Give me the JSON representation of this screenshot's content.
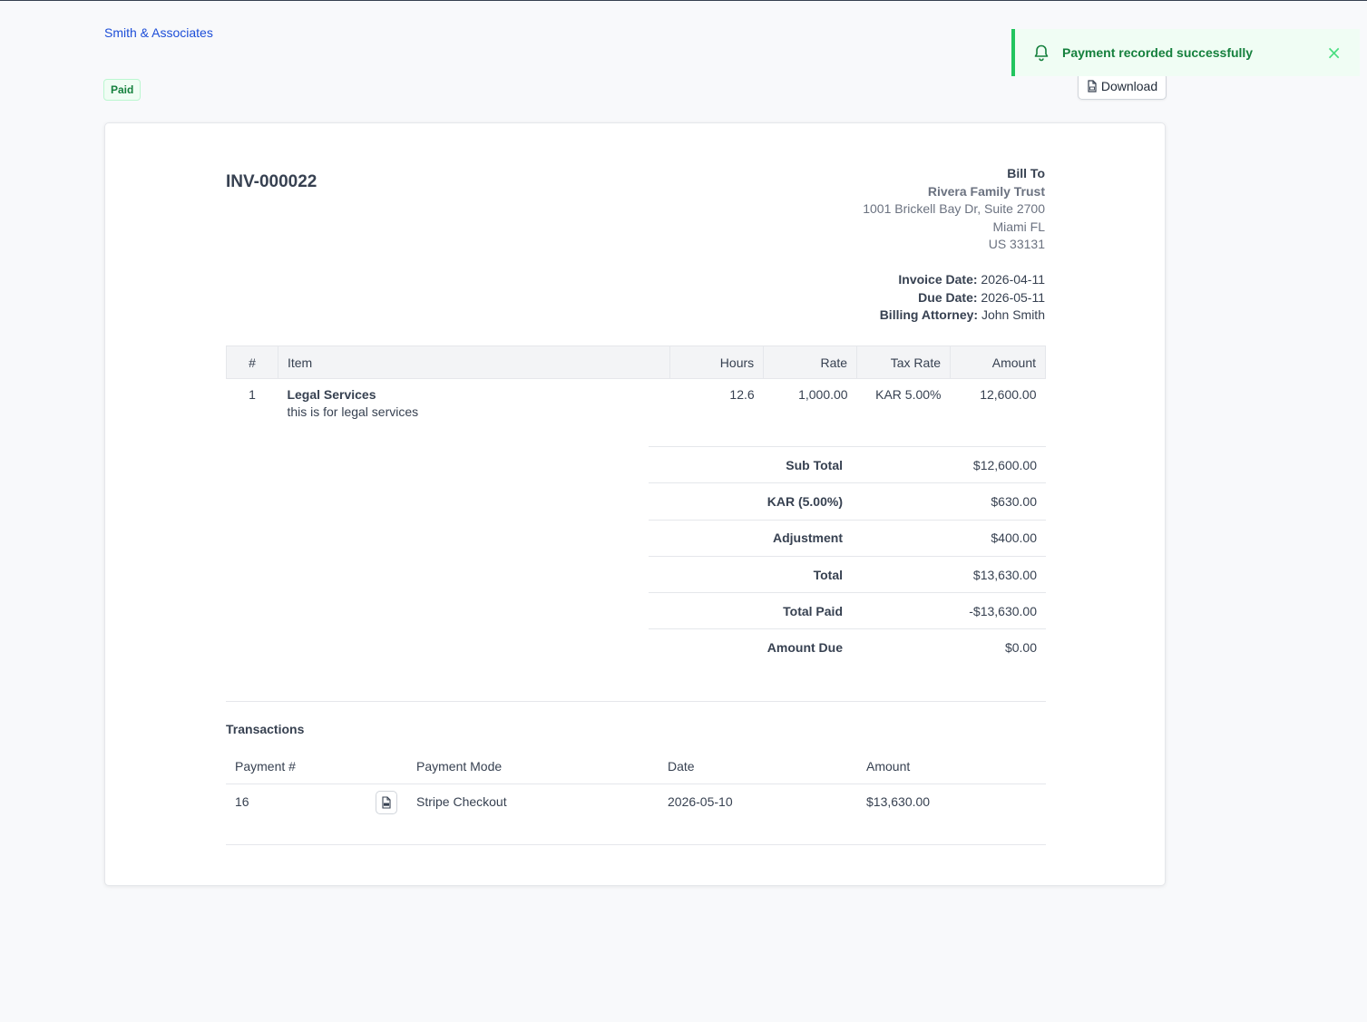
{
  "header": {
    "firm_name": "Smith & Associates",
    "status": "Paid",
    "download_label": "Download"
  },
  "toast": {
    "message": "Payment recorded successfully",
    "close": "×"
  },
  "invoice": {
    "number": "INV-000022",
    "bill_to": {
      "heading": "Bill To",
      "name": "Rivera Family Trust",
      "address_line1": "1001 Brickell Bay Dr, Suite 2700",
      "address_line2": "Miami FL",
      "address_line3": "US 33131"
    },
    "meta": {
      "invoice_date_label": "Invoice Date:",
      "invoice_date": "2026-04-11",
      "due_date_label": "Due Date:",
      "due_date": "2026-05-11",
      "attorney_label": "Billing Attorney:",
      "attorney": "John Smith"
    },
    "items_table": {
      "headers": [
        "#",
        "Item",
        "Hours",
        "Rate",
        "Tax Rate",
        "Amount"
      ],
      "rows": [
        {
          "num": "1",
          "name": "Legal Services",
          "description": "this is for legal services",
          "hours": "12.6",
          "rate": "1,000.00",
          "tax_rate": "KAR 5.00%",
          "amount": "12,600.00"
        }
      ]
    },
    "totals": [
      {
        "label": "Sub Total",
        "value": "$12,600.00"
      },
      {
        "label": "KAR (5.00%)",
        "value": "$630.00"
      },
      {
        "label": "Adjustment",
        "value": "$400.00"
      },
      {
        "label": "Total",
        "value": "$13,630.00"
      },
      {
        "label": "Total Paid",
        "value": "-$13,630.00"
      },
      {
        "label": "Amount Due",
        "value": "$0.00"
      }
    ]
  },
  "transactions": {
    "title": "Transactions",
    "headers": [
      "Payment #",
      "Payment Mode",
      "Date",
      "Amount"
    ],
    "rows": [
      {
        "payment_no": "16",
        "mode": "Stripe Checkout",
        "date": "2026-05-10",
        "amount": "$13,630.00"
      }
    ]
  },
  "colors": {
    "accent": "#1d4ed8",
    "success": "#15803d",
    "success_bg": "#f0fdf4",
    "toast_border": "#22c55e"
  },
  "icons": {
    "toast": "bell-icon",
    "download": "document-icon",
    "receipt": "pdf-icon",
    "close": "close-icon"
  }
}
